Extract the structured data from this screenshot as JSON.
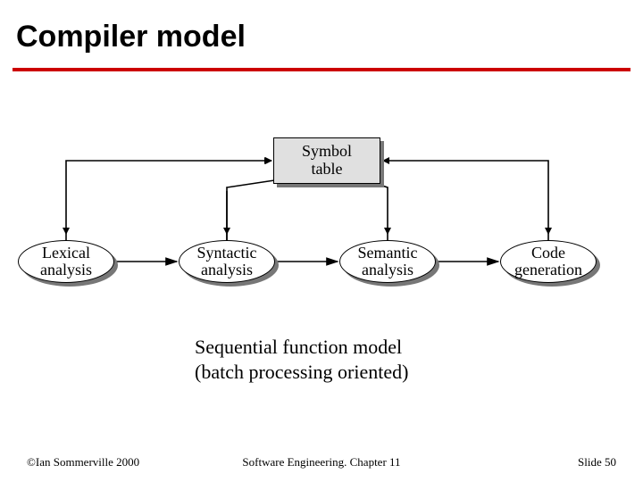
{
  "title": "Compiler model",
  "nodes": {
    "symbol_table": "Symbol\ntable",
    "lexical": "Lexical\nanalysis",
    "syntactic": "Syntactic\nanalysis",
    "semantic": "Semantic\nanalysis",
    "codegen": "Code\ngeneration"
  },
  "caption_line1": "Sequential function model",
  "caption_line2": "(batch processing oriented)",
  "footer": {
    "left": "©Ian Sommerville 2000",
    "center": "Software Engineering. Chapter 11",
    "right": "Slide 50"
  }
}
